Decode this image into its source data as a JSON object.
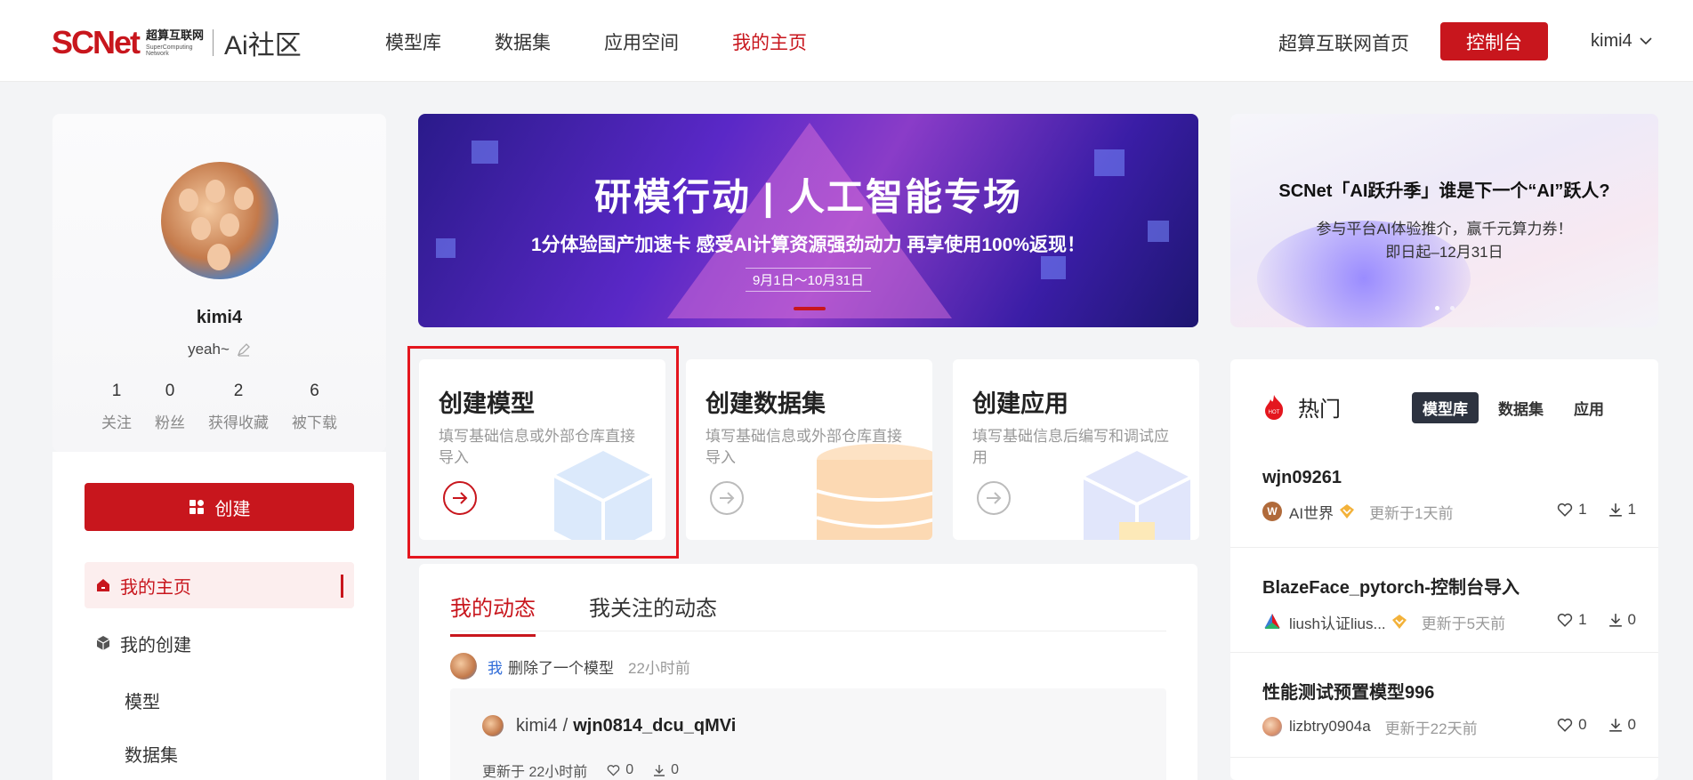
{
  "header": {
    "logo_mark": "SCNet",
    "logo_cn": "超算互联网",
    "logo_en": "SuperComputing Network",
    "logo_ai": "Ai社区",
    "nav": [
      {
        "label": "模型库",
        "active": false
      },
      {
        "label": "数据集",
        "active": false
      },
      {
        "label": "应用空间",
        "active": false
      },
      {
        "label": "我的主页",
        "active": true
      }
    ],
    "home_link": "超算互联网首页",
    "console_label": "控制台",
    "user": "kimi4"
  },
  "profile": {
    "username": "kimi4",
    "bio": "yeah~",
    "stats": [
      {
        "num": "1",
        "label": "关注"
      },
      {
        "num": "0",
        "label": "粉丝"
      },
      {
        "num": "2",
        "label": "获得收藏"
      },
      {
        "num": "6",
        "label": "被下载"
      }
    ]
  },
  "left_menu": {
    "create_label": "创建",
    "home_label": "我的主页",
    "my_create_label": "我的创建",
    "sub_items": [
      "模型",
      "数据集"
    ]
  },
  "banner_main": {
    "title": "研模行动 | 人工智能专场",
    "subtitle": "1分体验国产加速卡 感受AI计算资源强劲动力 再享使用100%返现！",
    "date": "9月1日～10月31日"
  },
  "banner_side": {
    "title": "SCNet「AI跃升季」谁是下一个“AI”跃人?",
    "line1": "参与平台AI体验推介，赢千元算力券！",
    "line2": "即日起–12月31日"
  },
  "quick_cards": [
    {
      "title": "创建模型",
      "desc": "填写基础信息或外部仓库直接导入"
    },
    {
      "title": "创建数据集",
      "desc": "填写基础信息或外部仓库直接导入"
    },
    {
      "title": "创建应用",
      "desc": "填写基础信息后编写和调试应用"
    }
  ],
  "activity": {
    "tabs": [
      "我的动态",
      "我关注的动态"
    ],
    "actor": "我",
    "action": "删除了一个模型",
    "time": "22小时前",
    "card": {
      "owner": "kimi4",
      "sep": "/",
      "name": "wjn0814_dcu_qMVi",
      "updated": "更新于 22小时前",
      "likes": "0",
      "downloads": "0"
    }
  },
  "hot": {
    "title": "热门",
    "badge": "HOT",
    "tabs": [
      "模型库",
      "数据集",
      "应用"
    ],
    "items": [
      {
        "name": "wjn09261",
        "org": "AI世界",
        "org_initial": "W",
        "org_color": "#b06a3a",
        "vip": true,
        "updated": "更新于1天前",
        "likes": "1",
        "downloads": "1"
      },
      {
        "name": "BlazeFace_pytorch-控制台导入",
        "org": "liush认证lius...",
        "org_initial": "▲",
        "org_color": "#ffffff",
        "vip": true,
        "updated": "更新于5天前",
        "likes": "1",
        "downloads": "0"
      },
      {
        "name": "性能测试预置模型996",
        "org": "lizbtry0904a",
        "org_initial": "",
        "org_color": "#f2c7a3",
        "vip": false,
        "updated": "更新于22天前",
        "likes": "0",
        "downloads": "0"
      }
    ]
  },
  "colors": {
    "brand": "#c8161d",
    "highlight": "#e4161e"
  }
}
